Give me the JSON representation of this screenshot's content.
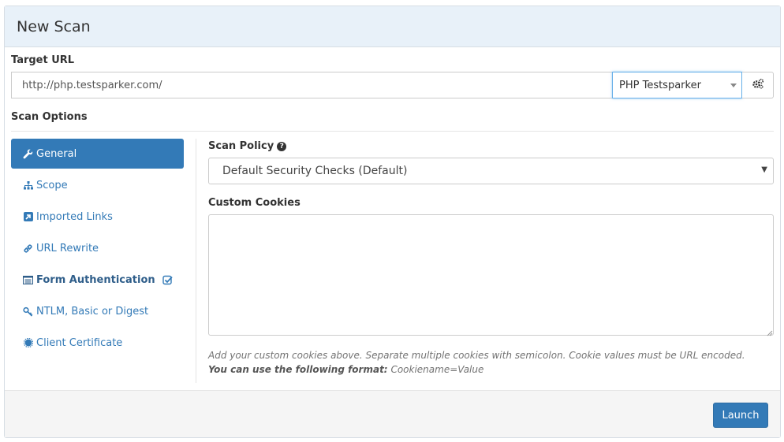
{
  "header": {
    "title": "New Scan"
  },
  "target": {
    "label": "Target URL",
    "url_value": "http://php.testsparker.com/",
    "profile_selected": "PHP Testsparker"
  },
  "scan_options": {
    "label": "Scan Options"
  },
  "nav": {
    "items": [
      {
        "label": "General",
        "icon": "wrench-icon"
      },
      {
        "label": "Scope",
        "icon": "sitemap-icon"
      },
      {
        "label": "Imported Links",
        "icon": "import-icon"
      },
      {
        "label": "URL Rewrite",
        "icon": "link-icon"
      },
      {
        "label": "Form Authentication",
        "icon": "form-icon"
      },
      {
        "label": "NTLM, Basic or Digest",
        "icon": "key-icon"
      },
      {
        "label": "Client Certificate",
        "icon": "certificate-icon"
      }
    ]
  },
  "general": {
    "policy_label": "Scan Policy",
    "policy_selected": "Default Security Checks (Default)",
    "cookies_label": "Custom Cookies",
    "cookies_value": "",
    "help_line1": "Add your custom cookies above. Separate multiple cookies with semicolon. Cookie values must be URL encoded.",
    "help_format_label": "You can use the following format:",
    "help_format_value": "Cookiename=Value"
  },
  "footer": {
    "launch_label": "Launch"
  },
  "colors": {
    "primary": "#337ab7",
    "header_bg": "#e8f1f9",
    "footer_bg": "#f5f5f5"
  }
}
